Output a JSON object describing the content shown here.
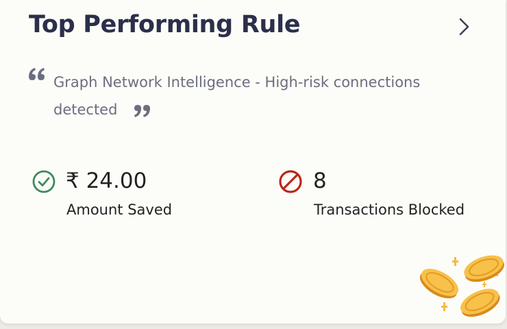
{
  "card": {
    "title": "Top Performing Rule",
    "rule_description": "Graph Network Intelligence - High-risk connections detected"
  },
  "stats": {
    "saved": {
      "value": "₹ 24.00",
      "label": "Amount Saved"
    },
    "blocked": {
      "value": "8",
      "label": "Transactions Blocked"
    }
  },
  "icons": {
    "chevron": "chevron-right-icon",
    "quote_open": "quote-open-icon",
    "quote_close": "quote-close-icon",
    "saved": "check-circle-icon",
    "blocked": "prohibited-icon",
    "coins": "gold-coins-icon"
  },
  "colors": {
    "title": "#2b2f4a",
    "description": "#6c6e7f",
    "success_green": "#3d8a5a",
    "blocked_red": "#b8281a",
    "coin_gold": "#f4b63c"
  }
}
